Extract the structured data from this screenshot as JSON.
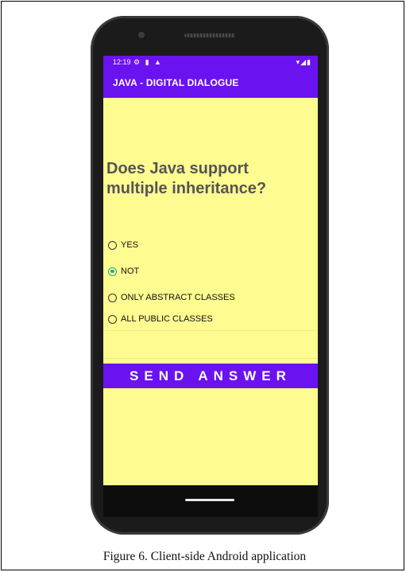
{
  "status_bar": {
    "time": "12:19",
    "left_icons": "⚙ ▮ ▲",
    "right_icons": "▾◢▮"
  },
  "app_bar": {
    "title": "JAVA - DIGITAL DIALOGUE"
  },
  "question": {
    "text": "Does Java support multiple inheritance?"
  },
  "options": [
    {
      "label": "YES",
      "checked": false
    },
    {
      "label": "NOT",
      "checked": true
    },
    {
      "label": "ONLY ABSTRACT CLASSES",
      "checked": false
    },
    {
      "label": "ALL PUBLIC CLASSES",
      "checked": false
    }
  ],
  "send_button": {
    "label": "SEND ANSWER"
  },
  "caption": {
    "text": "Figure 6.    Client-side Android application"
  },
  "colors": {
    "primary": "#6a12f0",
    "background": "#fefb90",
    "radio_checked": "#1fa89a"
  }
}
